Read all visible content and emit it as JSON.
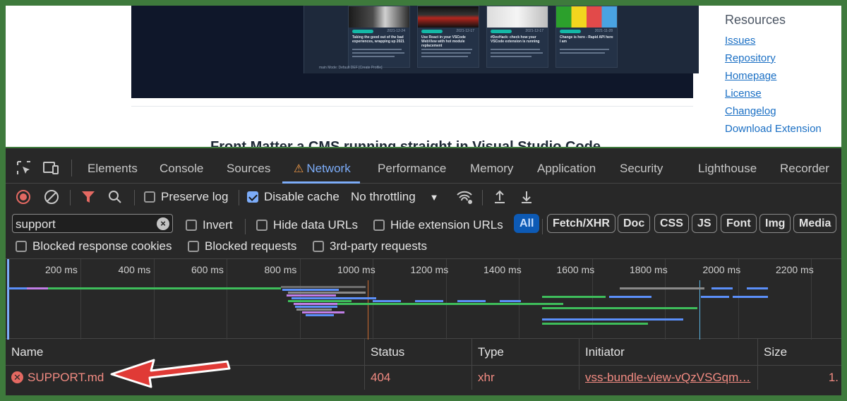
{
  "page": {
    "article_title": "Front Matter a CMS running straight in Visual Studio Code",
    "resources": {
      "heading": "Resources",
      "links": [
        "Issues",
        "Repository",
        "Homepage",
        "License",
        "Changelog",
        "Download Extension"
      ]
    },
    "cards": [
      {
        "date": "2021-12-24",
        "title": "Taking the good out of the bad experiences, wrapping up 2021"
      },
      {
        "date": "2021-12-17",
        "title": "Use React in your VSCode WebView with hot module replacement"
      },
      {
        "date": "2021-12-17",
        "title": "#DevHack: check how your VSCode extension is running"
      },
      {
        "date": "2021-11-28",
        "title": "Change is here - Rapid API here I am"
      }
    ],
    "status_bar": "main   Mode: Default   DEF [Create Profile]"
  },
  "devtools": {
    "tabs": [
      "Elements",
      "Console",
      "Sources",
      "Network",
      "Performance",
      "Memory",
      "Application",
      "Security",
      "Lighthouse",
      "Recorder"
    ],
    "active_tab": "Network",
    "toolbar": {
      "preserve_log": "Preserve log",
      "preserve_log_checked": false,
      "disable_cache": "Disable cache",
      "disable_cache_checked": true,
      "throttling": "No throttling"
    },
    "filter": {
      "search_value": "support",
      "invert": "Invert",
      "hide_data_urls": "Hide data URLs",
      "hide_extension_urls": "Hide extension URLs",
      "types": [
        "All",
        "Fetch/XHR",
        "Doc",
        "CSS",
        "JS",
        "Font",
        "Img",
        "Media"
      ],
      "active_type": "All"
    },
    "filter2": {
      "blocked_cookies": "Blocked response cookies",
      "blocked_requests": "Blocked requests",
      "third_party": "3rd-party requests"
    },
    "timeline": {
      "ticks": [
        "200 ms",
        "400 ms",
        "600 ms",
        "800 ms",
        "1000 ms",
        "1200 ms",
        "1400 ms",
        "1600 ms",
        "1800 ms",
        "2000 ms",
        "2200 ms"
      ]
    },
    "table": {
      "headers": [
        "Name",
        "Status",
        "Type",
        "Initiator",
        "Size"
      ],
      "rows": [
        {
          "name": "SUPPORT.md",
          "status": "404",
          "type": "xhr",
          "initiator": "vss-bundle-view-vQzVSGqm…",
          "size": "1."
        }
      ]
    }
  },
  "colors": {
    "accent": "#7cacf8",
    "error": "#f28b82",
    "annotation_arrow": "#e03a36",
    "frame": "#3e7a3c"
  }
}
